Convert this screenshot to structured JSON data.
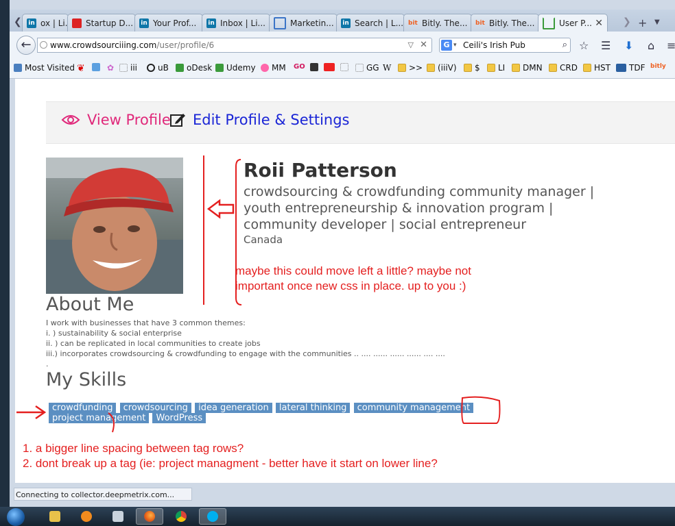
{
  "browser": {
    "tabs": [
      {
        "label": "ox | Li...",
        "icon": "linkedin-icon"
      },
      {
        "label": "Startup D...",
        "icon": "startup-icon"
      },
      {
        "label": "Your Prof...",
        "icon": "linkedin-icon"
      },
      {
        "label": "Inbox | Li...",
        "icon": "linkedin-icon"
      },
      {
        "label": "Marketin...",
        "icon": "marketing-icon"
      },
      {
        "label": "Search | L...",
        "icon": "linkedin-icon"
      },
      {
        "label": "Bitly. The...",
        "icon": "bitly-icon"
      },
      {
        "label": "Bitly. The...",
        "icon": "bitly-icon"
      },
      {
        "label": "User P...",
        "icon": "loading-icon",
        "active": true
      }
    ],
    "url_domain": "www.crowdsourciiing.com",
    "url_path": "/user/profile/6",
    "search_value": "Ceili's Irish Pub",
    "search_engine_icon": "G",
    "bookmarks": [
      {
        "label": "Most Visited",
        "icon": "most-visited-icon"
      },
      {
        "label": "",
        "icon": "maple-leaf-icon"
      },
      {
        "label": "",
        "icon": "translate-icon"
      },
      {
        "label": "",
        "icon": "flower-icon"
      },
      {
        "label": "iii",
        "icon": "dotted-box-icon"
      },
      {
        "label": "uB",
        "icon": "ublock-icon"
      },
      {
        "label": "oDesk",
        "icon": "odesk-icon"
      },
      {
        "label": "Udemy",
        "icon": "udemy-icon"
      },
      {
        "label": "MM",
        "icon": "mm-icon"
      },
      {
        "label": "",
        "icon": "go-icon",
        "text": "GO"
      },
      {
        "label": "",
        "icon": "owl-icon"
      },
      {
        "label": "",
        "icon": "youtube-icon"
      },
      {
        "label": "",
        "icon": "dotted-box-icon"
      },
      {
        "label": "GG",
        "icon": "dotted-box-icon"
      },
      {
        "label": "",
        "icon": "wikipedia-icon",
        "text": "W"
      },
      {
        "label": ">>",
        "icon": "folder-icon"
      },
      {
        "label": "(iiiV)",
        "icon": "folder-icon"
      },
      {
        "label": "$",
        "icon": "folder-icon"
      },
      {
        "label": "LI",
        "icon": "folder-icon"
      },
      {
        "label": "DMN",
        "icon": "folder-icon"
      },
      {
        "label": "CRD",
        "icon": "folder-icon"
      },
      {
        "label": "HST",
        "icon": "folder-icon"
      },
      {
        "label": "TDF",
        "icon": "monitor-icon"
      },
      {
        "label": "",
        "icon": "bitly-icon",
        "text": "bitly"
      }
    ],
    "status_text": "Connecting to collector.deepmetrix.com..."
  },
  "profile": {
    "view_label": "View Profile",
    "edit_label": "Edit Profile & Settings",
    "name": "Roii Patterson",
    "headline": "crowdsourcing & crowdfunding community manager | youth entrepreneurship & innovation program | community developer | social entrepreneur",
    "location": "Canada",
    "about_title": "About Me",
    "about_lines": [
      "I work with businesses that have 3 common themes:",
      "i. ) sustainability & social enterprise",
      "ii. ) can be replicated in local communities to create jobs",
      "iii.) incorporates crowdsourcing & crowdfunding to engage with the communities .. .... ...... ...... ...... .... ....",
      "."
    ],
    "skills_title": "My Skills",
    "skills": [
      "crowdfunding",
      "crowdsourcing",
      "idea generation",
      "lateral thinking",
      "community management",
      "project management",
      "WordPress"
    ]
  },
  "annotations": {
    "note1_line1": "maybe this could move left a little? maybe not",
    "note1_line2": "important once new css in place. up to you :)",
    "note2_line1": "1. a bigger line spacing between tag rows?",
    "note2_line2": "2. dont break up a tag (ie: project managment - better have it start on lower line?",
    "color": "#e41f1f"
  },
  "colors": {
    "view_link": "#e0287a",
    "edit_link": "#1a25d6",
    "tag_bg": "#5b8fc2"
  },
  "taskbar": {
    "items": [
      "explorer-icon",
      "media-player-icon",
      "window-icon",
      "firefox-icon",
      "chrome-icon",
      "skype-icon"
    ]
  }
}
